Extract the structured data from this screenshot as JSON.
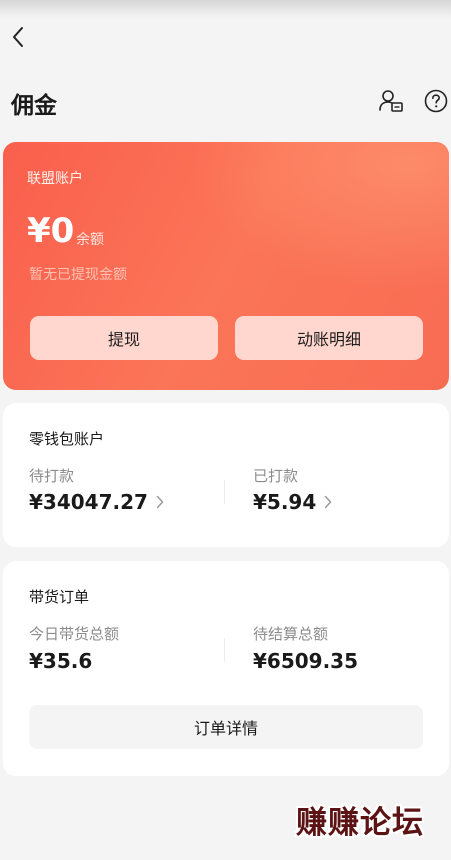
{
  "header": {
    "title": "佣金",
    "back_icon": "chevron-left-icon",
    "account_icon": "user-card-icon",
    "help_icon": "question-circle-icon"
  },
  "alliance_account": {
    "title": "联盟账户",
    "amount": "¥0",
    "amount_label": "余额",
    "hint": "暂无已提现金额",
    "withdraw_label": "提现",
    "transactions_label": "动账明细",
    "accent_color": "#fa5f4d"
  },
  "wallet_account": {
    "title": "零钱包账户",
    "pending_label": "待打款",
    "pending_value": "¥34047.27",
    "paid_label": "已打款",
    "paid_value": "¥5.94"
  },
  "orders": {
    "title": "带货订单",
    "today_label": "今日带货总额",
    "today_value": "¥35.6",
    "unsettled_label": "待结算总额",
    "unsettled_value": "¥6509.35",
    "detail_button_label": "订单详情"
  },
  "watermark": "赚赚论坛"
}
